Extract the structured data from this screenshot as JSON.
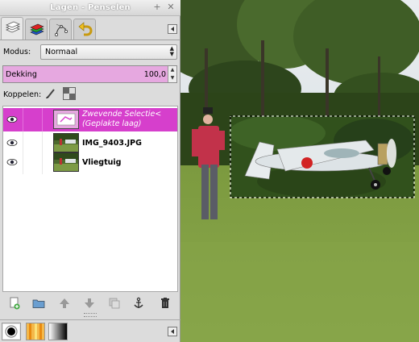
{
  "window": {
    "title": "Lagen - Penselen"
  },
  "mode": {
    "label": "Modus:",
    "value": "Normaal"
  },
  "opacity": {
    "label": "Dekking",
    "value": "100,0"
  },
  "lock": {
    "label": "Koppelen:"
  },
  "layers": [
    {
      "name_line1": "Zwevende Selectie<",
      "name_line2": "(Geplakte laag)",
      "selected": true
    },
    {
      "name": "IMG_9403.JPG",
      "selected": false
    },
    {
      "name": "Vliegtuig",
      "selected": false
    }
  ],
  "colors": {
    "selection": "#d63fcc",
    "opacity_bar": "#e6a8e0"
  },
  "icons": {
    "tabs": [
      "layers-icon",
      "channels-icon",
      "paths-icon",
      "undo-history-icon"
    ],
    "layer_buttons": [
      "new-layer-icon",
      "new-group-icon",
      "raise-layer-icon",
      "lower-layer-icon",
      "duplicate-layer-icon",
      "anchor-layer-icon",
      "delete-layer-icon"
    ],
    "dock_tabs": [
      "brushes-icon",
      "patterns-icon",
      "gradients-icon"
    ]
  }
}
